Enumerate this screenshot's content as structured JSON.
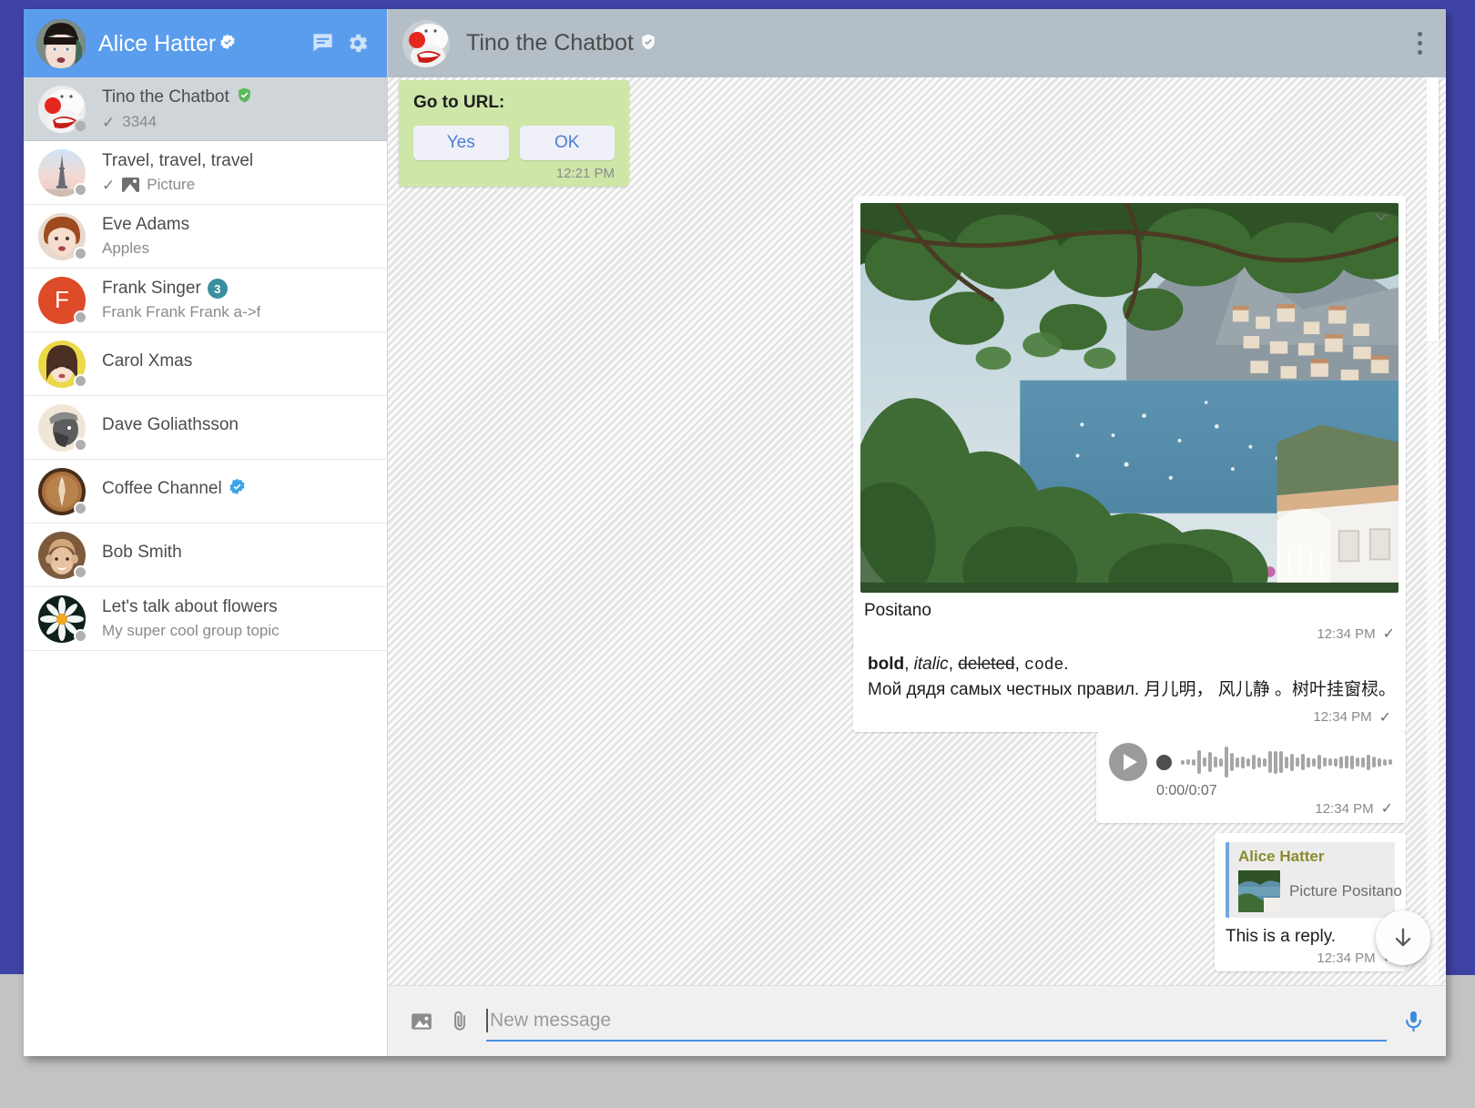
{
  "sidebar": {
    "header": {
      "user_name": "Alice Hatter",
      "verified": true,
      "verified_icon": "verified-badge-icon",
      "new_chat_icon": "chat-bubble-icon",
      "settings_icon": "gear-icon",
      "avatar_name": "alice-hatter-avatar"
    },
    "items": [
      {
        "name": "Tino the Chatbot",
        "preview": "3344",
        "badge": "",
        "verified": true,
        "verified_color": "#5bb85b",
        "tick": true,
        "picture_label": "",
        "active": true,
        "avatar_kind": "photo-clown"
      },
      {
        "name": "Travel, travel, travel",
        "preview": "Picture",
        "badge": "",
        "verified": false,
        "tick": true,
        "has_pic_icon": true,
        "active": false,
        "avatar_kind": "photo-eiffel"
      },
      {
        "name": "Eve Adams",
        "preview": "Apples",
        "badge": "",
        "verified": false,
        "tick": false,
        "active": false,
        "avatar_kind": "photo-eve"
      },
      {
        "name": "Frank Singer",
        "preview": "Frank Frank Frank a->f",
        "badge": "3",
        "verified": false,
        "tick": false,
        "active": false,
        "avatar_kind": "letter",
        "avatar_letter": "F",
        "avatar_color": "#dd4b28"
      },
      {
        "name": "Carol Xmas",
        "preview": "",
        "badge": "",
        "verified": false,
        "tick": false,
        "active": false,
        "avatar_kind": "photo-carol"
      },
      {
        "name": "Dave Goliathsson",
        "preview": "",
        "badge": "",
        "verified": false,
        "tick": false,
        "active": false,
        "avatar_kind": "photo-dave"
      },
      {
        "name": "Coffee Channel",
        "preview": "",
        "badge": "",
        "verified": true,
        "verified_color": "#3ba3e8",
        "tick": false,
        "active": false,
        "avatar_kind": "photo-coffee"
      },
      {
        "name": "Bob Smith",
        "preview": "",
        "badge": "",
        "verified": false,
        "tick": false,
        "active": false,
        "avatar_kind": "photo-bob"
      },
      {
        "name": "Let's talk about flowers",
        "preview": "My super cool group topic",
        "badge": "",
        "verified": false,
        "tick": false,
        "active": false,
        "avatar_kind": "photo-lotus"
      }
    ]
  },
  "chat": {
    "header": {
      "title": "Tino the Chatbot",
      "verified": true,
      "verified_icon": "verified-shield-icon",
      "menu_icon": "kebab-menu-icon",
      "avatar_name": "tino-chatbot-avatar"
    },
    "messages": {
      "keyboard": {
        "title": "Go to URL:",
        "buttons": [
          "Yes",
          "OK"
        ],
        "time": "12:21 PM"
      },
      "photo": {
        "caption": "Positano",
        "time": "12:34 PM",
        "tick": "✓",
        "collapse_icon": "chevron-down-icon"
      },
      "formatted": {
        "bold": "bold",
        "sep1": ", ",
        "italic": "italic",
        "sep2": ", ",
        "strike": "deleted",
        "sep3": ", ",
        "code": "code",
        "period": ".",
        "line2": "Мой дядя самых честных правил. 月儿明， 风儿静 。树叶挂窗棂。",
        "time": "12:34 PM",
        "tick": "✓"
      },
      "voice": {
        "play_icon": "play-icon",
        "position": "0:00/0:07",
        "time": "12:34 PM",
        "tick": "✓"
      },
      "reply": {
        "quote_author": "Alice Hatter",
        "quote_text": "Picture Positano",
        "text": "This is a reply.",
        "time": "12:34 PM",
        "tick": "✓"
      }
    },
    "scroll_down_icon": "arrow-down-icon"
  },
  "composer": {
    "image_icon": "image-icon",
    "attach_icon": "paperclip-icon",
    "placeholder": "New message",
    "value": "",
    "mic_icon": "microphone-icon"
  },
  "colors": {
    "header_blue": "#5a9ded",
    "chat_header": "#b3bec6",
    "accent_blue": "#4a90e2",
    "green_bubble": "#cfe6a9",
    "badge_teal": "#3a8fa0",
    "backdrop": "#3f43a4"
  }
}
